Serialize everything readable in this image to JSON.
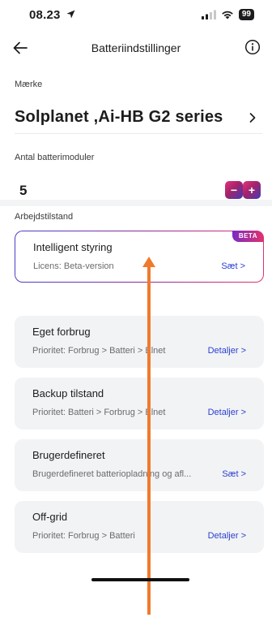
{
  "status_bar": {
    "time": "08.23",
    "battery": "99"
  },
  "header": {
    "title": "Batteriindstillinger",
    "back_icon": "arrow-left-icon",
    "info_icon": "info-circle-icon"
  },
  "brand": {
    "label": "Mærke",
    "value": "Solplanet ,Ai-HB G2 series"
  },
  "modules": {
    "label": "Antal batterimoduler",
    "value": "5",
    "decrement": "−",
    "increment": "+"
  },
  "work_mode": {
    "label": "Arbejdstilstand",
    "cards": [
      {
        "title": "Intelligent styring",
        "subtitle": "Licens: Beta-version",
        "link": "Sæt >",
        "badge": "BETA",
        "selected": true
      },
      {
        "title": "Eget forbrug",
        "subtitle": "Prioritet: Forbrug > Batteri > Elnet",
        "link": "Detaljer >"
      },
      {
        "title": "Backup tilstand",
        "subtitle": "Prioritet: Batteri > Forbrug > Elnet",
        "link": "Detaljer >"
      },
      {
        "title": "Brugerdefineret",
        "subtitle": "Brugerdefineret batteriopladning og afl...",
        "link": "Sæt >"
      },
      {
        "title": "Off-grid",
        "subtitle": "Prioritet: Forbrug > Batteri",
        "link": "Detaljer >"
      }
    ]
  },
  "colors": {
    "accent_link": "#2a3fcf",
    "gradient_start": "#e5317c",
    "gradient_end": "#4338b8",
    "annotation_arrow": "#f07a2c"
  }
}
